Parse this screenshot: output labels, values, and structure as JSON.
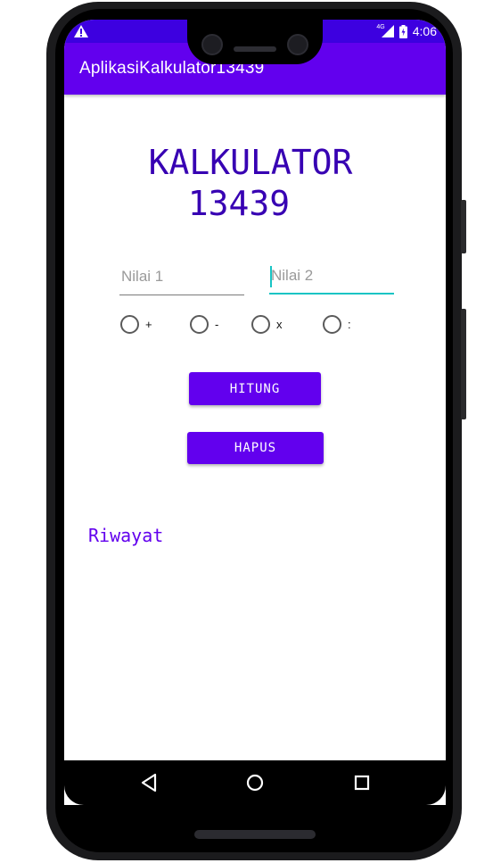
{
  "status_bar": {
    "time": "4:06",
    "network": "4G",
    "icons": [
      "warning-icon",
      "signal-icon",
      "battery-charging-icon"
    ]
  },
  "app_bar": {
    "title": "AplikasiKalkulator13439"
  },
  "heading": {
    "line1": "KALKULATOR",
    "line2": "13439"
  },
  "inputs": {
    "value1_placeholder": "Nilai 1",
    "value2_placeholder": "Nilai 2",
    "value1": "",
    "value2": ""
  },
  "operations": [
    {
      "label": "+"
    },
    {
      "label": "-"
    },
    {
      "label": "x"
    },
    {
      "label": ":"
    }
  ],
  "buttons": {
    "calculate": "HITUNG",
    "clear": "HAPUS"
  },
  "history": {
    "label": "Riwayat"
  },
  "nav": {
    "icons": [
      "back-icon",
      "home-icon",
      "recents-icon"
    ]
  },
  "colors": {
    "primary": "#6200ee",
    "primary_dark": "#3700b3",
    "accent": "#18c4c4",
    "text": "#111111"
  }
}
